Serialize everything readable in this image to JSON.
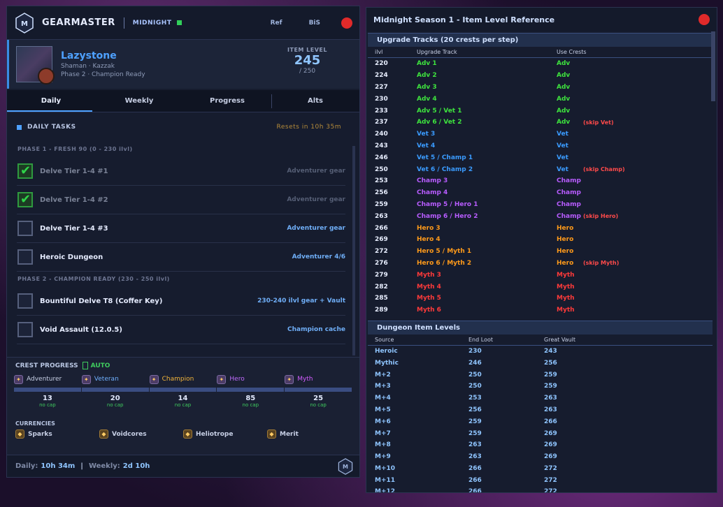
{
  "app": {
    "title": "GEARMASTER",
    "expansion": "MIDNIGHT",
    "ref": "Ref",
    "bis": "BiS"
  },
  "character": {
    "name": "Lazystone",
    "sub1": "Shaman  ·  Kazzak",
    "sub2": "Phase 2  ·  Champion Ready",
    "ilvl_label": "ITEM LEVEL",
    "ilvl": "245",
    "ilvl_max": "/ 250"
  },
  "tabs": [
    {
      "label": "Daily"
    },
    {
      "label": "Weekly"
    },
    {
      "label": "Progress"
    },
    {
      "label": "Alts"
    }
  ],
  "daily": {
    "title": "DAILY TASKS",
    "reset": "Resets in 10h 35m",
    "phase1": "PHASE 1  -  FRESH 90  (0 - 230 ilvl)",
    "phase2": "PHASE 2  -  CHAMPION READY  (230 - 250 ilvl)",
    "tasks1": [
      {
        "name": "Delve Tier 1-4  #1",
        "reward": "Adventurer gear",
        "done": true
      },
      {
        "name": "Delve Tier 1-4  #2",
        "reward": "Adventurer gear",
        "done": true
      },
      {
        "name": "Delve Tier 1-4  #3",
        "reward": "Adventurer gear",
        "done": false
      },
      {
        "name": "Heroic Dungeon",
        "reward": "Adventurer 4/6",
        "done": false
      }
    ],
    "tasks2": [
      {
        "name": "Bountiful Delve T8  (Coffer Key)",
        "reward": "230-240 ilvl gear + Vault",
        "done": false
      },
      {
        "name": "Void Assault  (12.0.5)",
        "reward": "Champion cache",
        "done": false
      }
    ]
  },
  "crests": {
    "title": "CREST PROGRESS",
    "auto": "AUTO",
    "items": [
      {
        "name": "Adventurer",
        "count": "13",
        "cap": "no cap",
        "color": "#c8d0e6"
      },
      {
        "name": "Veteran",
        "count": "20",
        "cap": "no cap",
        "color": "#6fb0ff"
      },
      {
        "name": "Champion",
        "count": "14",
        "cap": "no cap",
        "color": "#f2b43a"
      },
      {
        "name": "Hero",
        "count": "85",
        "cap": "no cap",
        "color": "#c06cff"
      },
      {
        "name": "Myth",
        "count": "25",
        "cap": "no cap",
        "color": "#d25cff"
      }
    ],
    "currencies_title": "CURRENCIES",
    "currencies": [
      {
        "name": "Sparks"
      },
      {
        "name": "Voidcores"
      },
      {
        "name": "Heliotrope"
      },
      {
        "name": "Merit"
      }
    ]
  },
  "footer": {
    "daily_label": "Daily:",
    "daily_value": "10h 34m",
    "sep": "|",
    "weekly_label": "Weekly:",
    "weekly_value": "2d 10h"
  },
  "reference": {
    "title": "Midnight Season 1  -  Item Level Reference",
    "tracks_title": "Upgrade Tracks  (20 crests per step)",
    "tracks_headers": {
      "ilvl": "ilvl",
      "track": "Upgrade Track",
      "crests": "Use Crests"
    },
    "tracks": [
      {
        "ilvl": "220",
        "track": "Adv 1",
        "crest": "Adv",
        "note": "",
        "cls": "adv",
        "ccls": "adv"
      },
      {
        "ilvl": "224",
        "track": "Adv 2",
        "crest": "Adv",
        "note": "",
        "cls": "adv",
        "ccls": "adv"
      },
      {
        "ilvl": "227",
        "track": "Adv 3",
        "crest": "Adv",
        "note": "",
        "cls": "adv",
        "ccls": "adv"
      },
      {
        "ilvl": "230",
        "track": "Adv 4",
        "crest": "Adv",
        "note": "",
        "cls": "adv",
        "ccls": "adv"
      },
      {
        "ilvl": "233",
        "track": "Adv 5 / Vet 1",
        "crest": "Adv",
        "note": "",
        "cls": "adv",
        "ccls": "adv"
      },
      {
        "ilvl": "237",
        "track": "Adv 6 / Vet 2",
        "crest": "Adv",
        "note": "(skip Vet)",
        "cls": "adv",
        "ccls": "adv"
      },
      {
        "ilvl": "240",
        "track": "Vet 3",
        "crest": "Vet",
        "note": "",
        "cls": "vet",
        "ccls": "vet"
      },
      {
        "ilvl": "243",
        "track": "Vet 4",
        "crest": "Vet",
        "note": "",
        "cls": "vet",
        "ccls": "vet"
      },
      {
        "ilvl": "246",
        "track": "Vet 5 / Champ 1",
        "crest": "Vet",
        "note": "",
        "cls": "vet",
        "ccls": "vet"
      },
      {
        "ilvl": "250",
        "track": "Vet 6 / Champ 2",
        "crest": "Vet",
        "note": "(skip Champ)",
        "cls": "vet",
        "ccls": "vet"
      },
      {
        "ilvl": "253",
        "track": "Champ 3",
        "crest": "Champ",
        "note": "",
        "cls": "champ",
        "ccls": "champ"
      },
      {
        "ilvl": "256",
        "track": "Champ 4",
        "crest": "Champ",
        "note": "",
        "cls": "champ",
        "ccls": "champ"
      },
      {
        "ilvl": "259",
        "track": "Champ 5 / Hero 1",
        "crest": "Champ",
        "note": "",
        "cls": "champ",
        "ccls": "champ"
      },
      {
        "ilvl": "263",
        "track": "Champ 6 / Hero 2",
        "crest": "Champ",
        "note": "(skip Hero)",
        "cls": "champ",
        "ccls": "champ"
      },
      {
        "ilvl": "266",
        "track": "Hero 3",
        "crest": "Hero",
        "note": "",
        "cls": "hero",
        "ccls": "hero"
      },
      {
        "ilvl": "269",
        "track": "Hero 4",
        "crest": "Hero",
        "note": "",
        "cls": "hero",
        "ccls": "hero"
      },
      {
        "ilvl": "272",
        "track": "Hero 5 / Myth 1",
        "crest": "Hero",
        "note": "",
        "cls": "hero",
        "ccls": "hero"
      },
      {
        "ilvl": "276",
        "track": "Hero 6 / Myth 2",
        "crest": "Hero",
        "note": "(skip Myth)",
        "cls": "hero",
        "ccls": "hero"
      },
      {
        "ilvl": "279",
        "track": "Myth 3",
        "crest": "Myth",
        "note": "",
        "cls": "myth",
        "ccls": "myth"
      },
      {
        "ilvl": "282",
        "track": "Myth 4",
        "crest": "Myth",
        "note": "",
        "cls": "myth",
        "ccls": "myth"
      },
      {
        "ilvl": "285",
        "track": "Myth 5",
        "crest": "Myth",
        "note": "",
        "cls": "myth",
        "ccls": "myth"
      },
      {
        "ilvl": "289",
        "track": "Myth 6",
        "crest": "Myth",
        "note": "",
        "cls": "myth",
        "ccls": "myth"
      }
    ],
    "dungeon_title": "Dungeon Item Levels",
    "dungeon_headers": {
      "source": "Source",
      "end": "End Loot",
      "vault": "Great Vault"
    },
    "dungeons": [
      {
        "source": "Heroic",
        "end": "230",
        "vault": "243"
      },
      {
        "source": "Mythic",
        "end": "246",
        "vault": "256"
      },
      {
        "source": "M+2",
        "end": "250",
        "vault": "259"
      },
      {
        "source": "M+3",
        "end": "250",
        "vault": "259"
      },
      {
        "source": "M+4",
        "end": "253",
        "vault": "263"
      },
      {
        "source": "M+5",
        "end": "256",
        "vault": "263"
      },
      {
        "source": "M+6",
        "end": "259",
        "vault": "266"
      },
      {
        "source": "M+7",
        "end": "259",
        "vault": "269"
      },
      {
        "source": "M+8",
        "end": "263",
        "vault": "269"
      },
      {
        "source": "M+9",
        "end": "263",
        "vault": "269"
      },
      {
        "source": "M+10",
        "end": "266",
        "vault": "272"
      },
      {
        "source": "M+11",
        "end": "266",
        "vault": "272"
      },
      {
        "source": "M+12",
        "end": "266",
        "vault": "272"
      }
    ]
  }
}
